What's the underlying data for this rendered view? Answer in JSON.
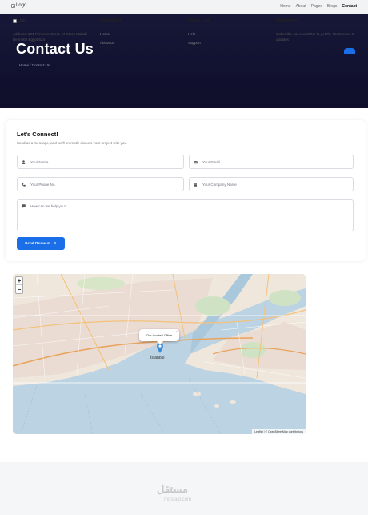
{
  "nav": {
    "logo_alt": "Logo",
    "links": [
      "Home",
      "About",
      "Pages",
      "Blogs",
      "Contact"
    ],
    "active": "Contact"
  },
  "hero": {
    "title": "Contact Us",
    "breadcrumb": "Home / Contact Us"
  },
  "form": {
    "title": "Let's Connect!",
    "subtitle": "Send us a message, and we'll promptly discuss your project with you.",
    "fields": {
      "name": {
        "placeholder": "Your Name",
        "icon": "user-icon"
      },
      "email": {
        "placeholder": "Your Email",
        "icon": "envelope-icon"
      },
      "phone": {
        "placeholder": "Your Phone No.",
        "icon": "phone-icon"
      },
      "company": {
        "placeholder": "Your Company Name",
        "icon": "building-icon"
      },
      "message": {
        "placeholder": "How can we help you?",
        "icon": "comment-icon"
      }
    },
    "submit_label": "Send Request",
    "submit_icon": "arrow-right-icon"
  },
  "map": {
    "zoom_in": "+",
    "zoom_out": "−",
    "popup": "Our located Office",
    "popup_close": "×",
    "city_label": "İstanbul",
    "attribution": "Leaflet | © OpenStreetMap contributors"
  },
  "footer": {
    "logo_alt": "Logo",
    "address": "Address: 384 Princess Street, El-Glass Mahalli Dennette Egypt-524",
    "navigation": {
      "heading": "Navigation",
      "links": [
        "Home",
        "About Us"
      ]
    },
    "quick_link": {
      "heading": "Quick Link",
      "links": [
        "Help",
        "Support"
      ]
    },
    "newsletter": {
      "heading": "Newsletter",
      "text": "Subscribe our newsletter to get the latest news & updates"
    }
  },
  "watermark": {
    "arabic": "مستقل",
    "latin": "mostaql.com"
  },
  "colors": {
    "accent": "#1a6fe8",
    "hero_bg": "#151534",
    "map_water": "#a9c8dc"
  }
}
